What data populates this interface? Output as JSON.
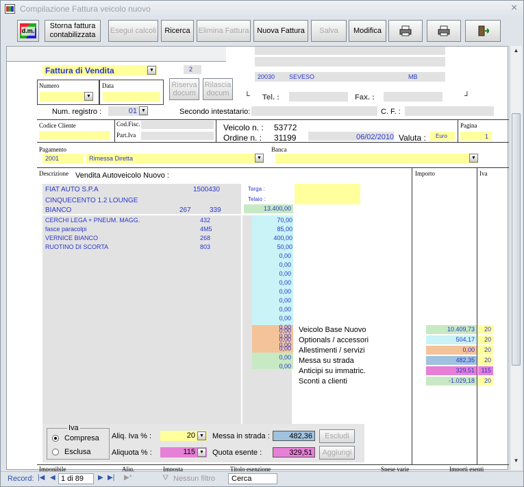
{
  "window": {
    "title": "Compilazione Fattura veicolo nuovo",
    "close": "×"
  },
  "toolbar": {
    "logo": "d.m.",
    "storna": "Storna fattura contabilizzata",
    "esegui": "Esegui calcoli",
    "ricerca": "Ricerca",
    "elimina": "Elimina Fattura",
    "nuova": "Nuova Fattura",
    "salva": "Salva",
    "modifica": "Modifica"
  },
  "header": {
    "tipo": "Fattura di Vendita",
    "copy_count": "2",
    "numero_label": "Numero",
    "data_label": "Data",
    "riserva": "Riserva docum",
    "rilascia": "Rilascia docum",
    "cap": "20030",
    "city": "SEVESO",
    "prov": "MB",
    "tel_label": "Tel. :",
    "fax_label": "Fax. :",
    "registro_label": "Num. registro :",
    "registro": "01",
    "secondo_label": "Secondo intestatario:",
    "cf_label": "C. F. :"
  },
  "cliente": {
    "codice_label": "Codice Cliente",
    "codfisc_label": "Cod.Fisc.",
    "partiva_label": "Part.Iva",
    "veicolo_label": "Veicolo n. :",
    "veicolo": "53772",
    "ordine_label": "Ordine n. :",
    "ordine": "31199",
    "data": "06/02/2010",
    "valuta_label": "Valuta :",
    "valuta": "Euro",
    "pagina_label": "Pagina",
    "pagina": "1"
  },
  "pagamento": {
    "label": "Pagamento",
    "code": "2001",
    "desc": "Rimessa Diretta",
    "banca_label": "Banca"
  },
  "righe": {
    "desc_label": "Descrizione",
    "desc": "Vendita Autoveicolo Nuovo :",
    "importo_label": "Importo",
    "iva_label": "Iva",
    "fornitore": "FIAT AUTO S.P.A",
    "fornitore_code": "1500430",
    "modello": "CINQUECENTO 1.2 LOUNGE",
    "colore": "BIANCO",
    "col_a": "267",
    "col_b": "339",
    "targa_label": "Targa :",
    "telaio_label": "Telaio :",
    "prezzo": "13.400,00",
    "optional": [
      {
        "desc": "CERCHI LEGA + PNEUM. MAGG.",
        "code": "432",
        "value": "70,00"
      },
      {
        "desc": "fasce paracolpi",
        "code": "4M5",
        "value": "85,00"
      },
      {
        "desc": "VERNICE BIANCO",
        "code": "268",
        "value": "400,00"
      },
      {
        "desc": "RUOTINO DI SCORTA",
        "code": "803",
        "value": "50,00"
      }
    ],
    "zeros": [
      "0,00",
      "0,00",
      "0,00",
      "0,00",
      "0,00",
      "0,00",
      "0,00",
      "0,00",
      "0,00",
      "0,00",
      "0,00"
    ],
    "extra": [
      "0,00",
      "0,00",
      "0,00",
      "0,00",
      "0,00"
    ],
    "summary": [
      {
        "label": "Veicolo Base Nuovo",
        "value": "10.409,73",
        "iva": "20",
        "color": "#c7e9c3"
      },
      {
        "label": "Optionals / accessori",
        "value": "504,17",
        "iva": "20",
        "color": "#c9f3f6"
      },
      {
        "label": "Allestimenti / servizi",
        "value": "0,00",
        "iva": "20",
        "color": "#f5c39a"
      },
      {
        "label": "Messa su strada",
        "value": "482,35",
        "iva": "20",
        "color": "#a0c2de"
      },
      {
        "label": "Anticipi su immatric.",
        "value": "329,51",
        "iva": "115",
        "color": "#e680d6"
      },
      {
        "label": "Sconti a clienti",
        "value": "-1.029,18",
        "iva": "20",
        "color": "#c7e9c3"
      }
    ]
  },
  "iva_box": {
    "title": "Iva",
    "compresa": "Compresa",
    "esclusa": "Esclusa",
    "aliq_iva_label": "Aliq. Iva % :",
    "aliq_iva": "20",
    "aliquota_label": "Aliquota % :",
    "aliquota": "115",
    "messa_label": "Messa in strada :",
    "messa": "482,36",
    "quota_label": "Quota esente :",
    "quota": "329,51",
    "escludi": "Escludi",
    "aggiungi": "Aggiungi"
  },
  "bottom": {
    "imponibile": "Imponibile",
    "aliq": "Aliq.",
    "imposta": "Imposta",
    "titolo": "Titolo esenzione",
    "spese": "Spese varie",
    "importi": "Importi esenti"
  },
  "status": {
    "record_label": "Record:",
    "record": "1 di 89",
    "filter": "Nessun filtro",
    "search": "Cerca"
  }
}
